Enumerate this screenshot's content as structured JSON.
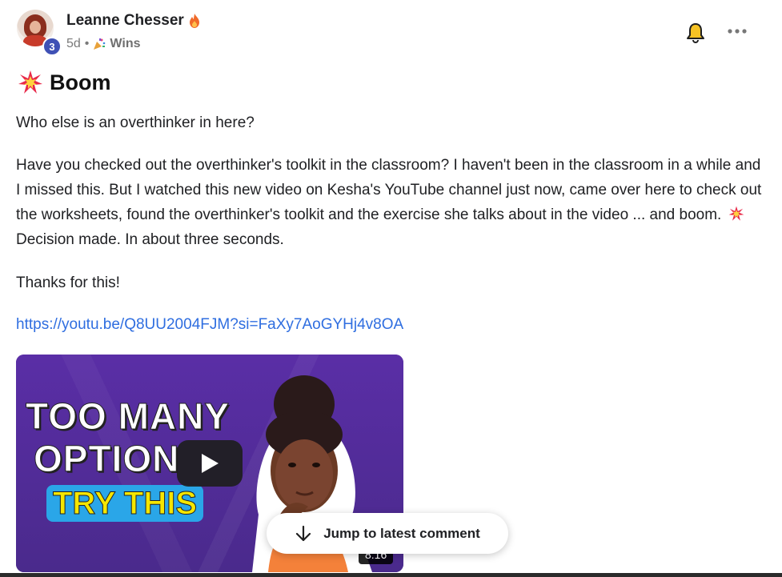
{
  "post": {
    "author": "Leanne Chesser",
    "level": "3",
    "age": "5d",
    "separator": "•",
    "category": "Wins",
    "title": "Boom",
    "paragraph1": "Who else is an overthinker in here?",
    "paragraph2_part1": "Have you checked out the overthinker's toolkit in the classroom? I haven't been in the classroom in a while and I missed this. But I watched this new video on Kesha's YouTube channel just now, came over here to check out the worksheets, found the overthinker's toolkit and the exercise she talks about in the video ... and boom.",
    "paragraph2_part2": "Decision made. In about three seconds.",
    "paragraph3": "Thanks for this!",
    "link": "https://youtu.be/Q8UU2004FJM?si=FaXy7AoGYHj4v8OA"
  },
  "video": {
    "line1": "TOO MANY",
    "line2": "OPTION",
    "line3": "TRY THIS",
    "duration": "8:16"
  },
  "jump_button": {
    "label": "Jump to latest comment"
  },
  "icons": {
    "author_badge": "flame-icon",
    "category": "party-popper-icon",
    "title": "collision-icon",
    "bell": "bell-icon",
    "more": "more-horizontal-icon",
    "play": "play-icon",
    "jump": "arrow-down-icon"
  },
  "colors": {
    "link": "#2f6ee0",
    "level_badge": "#3f51b5",
    "video_bg": "#4b2a8c",
    "try_this_bg": "#2aa6e8",
    "try_this_text": "#f5e600"
  }
}
